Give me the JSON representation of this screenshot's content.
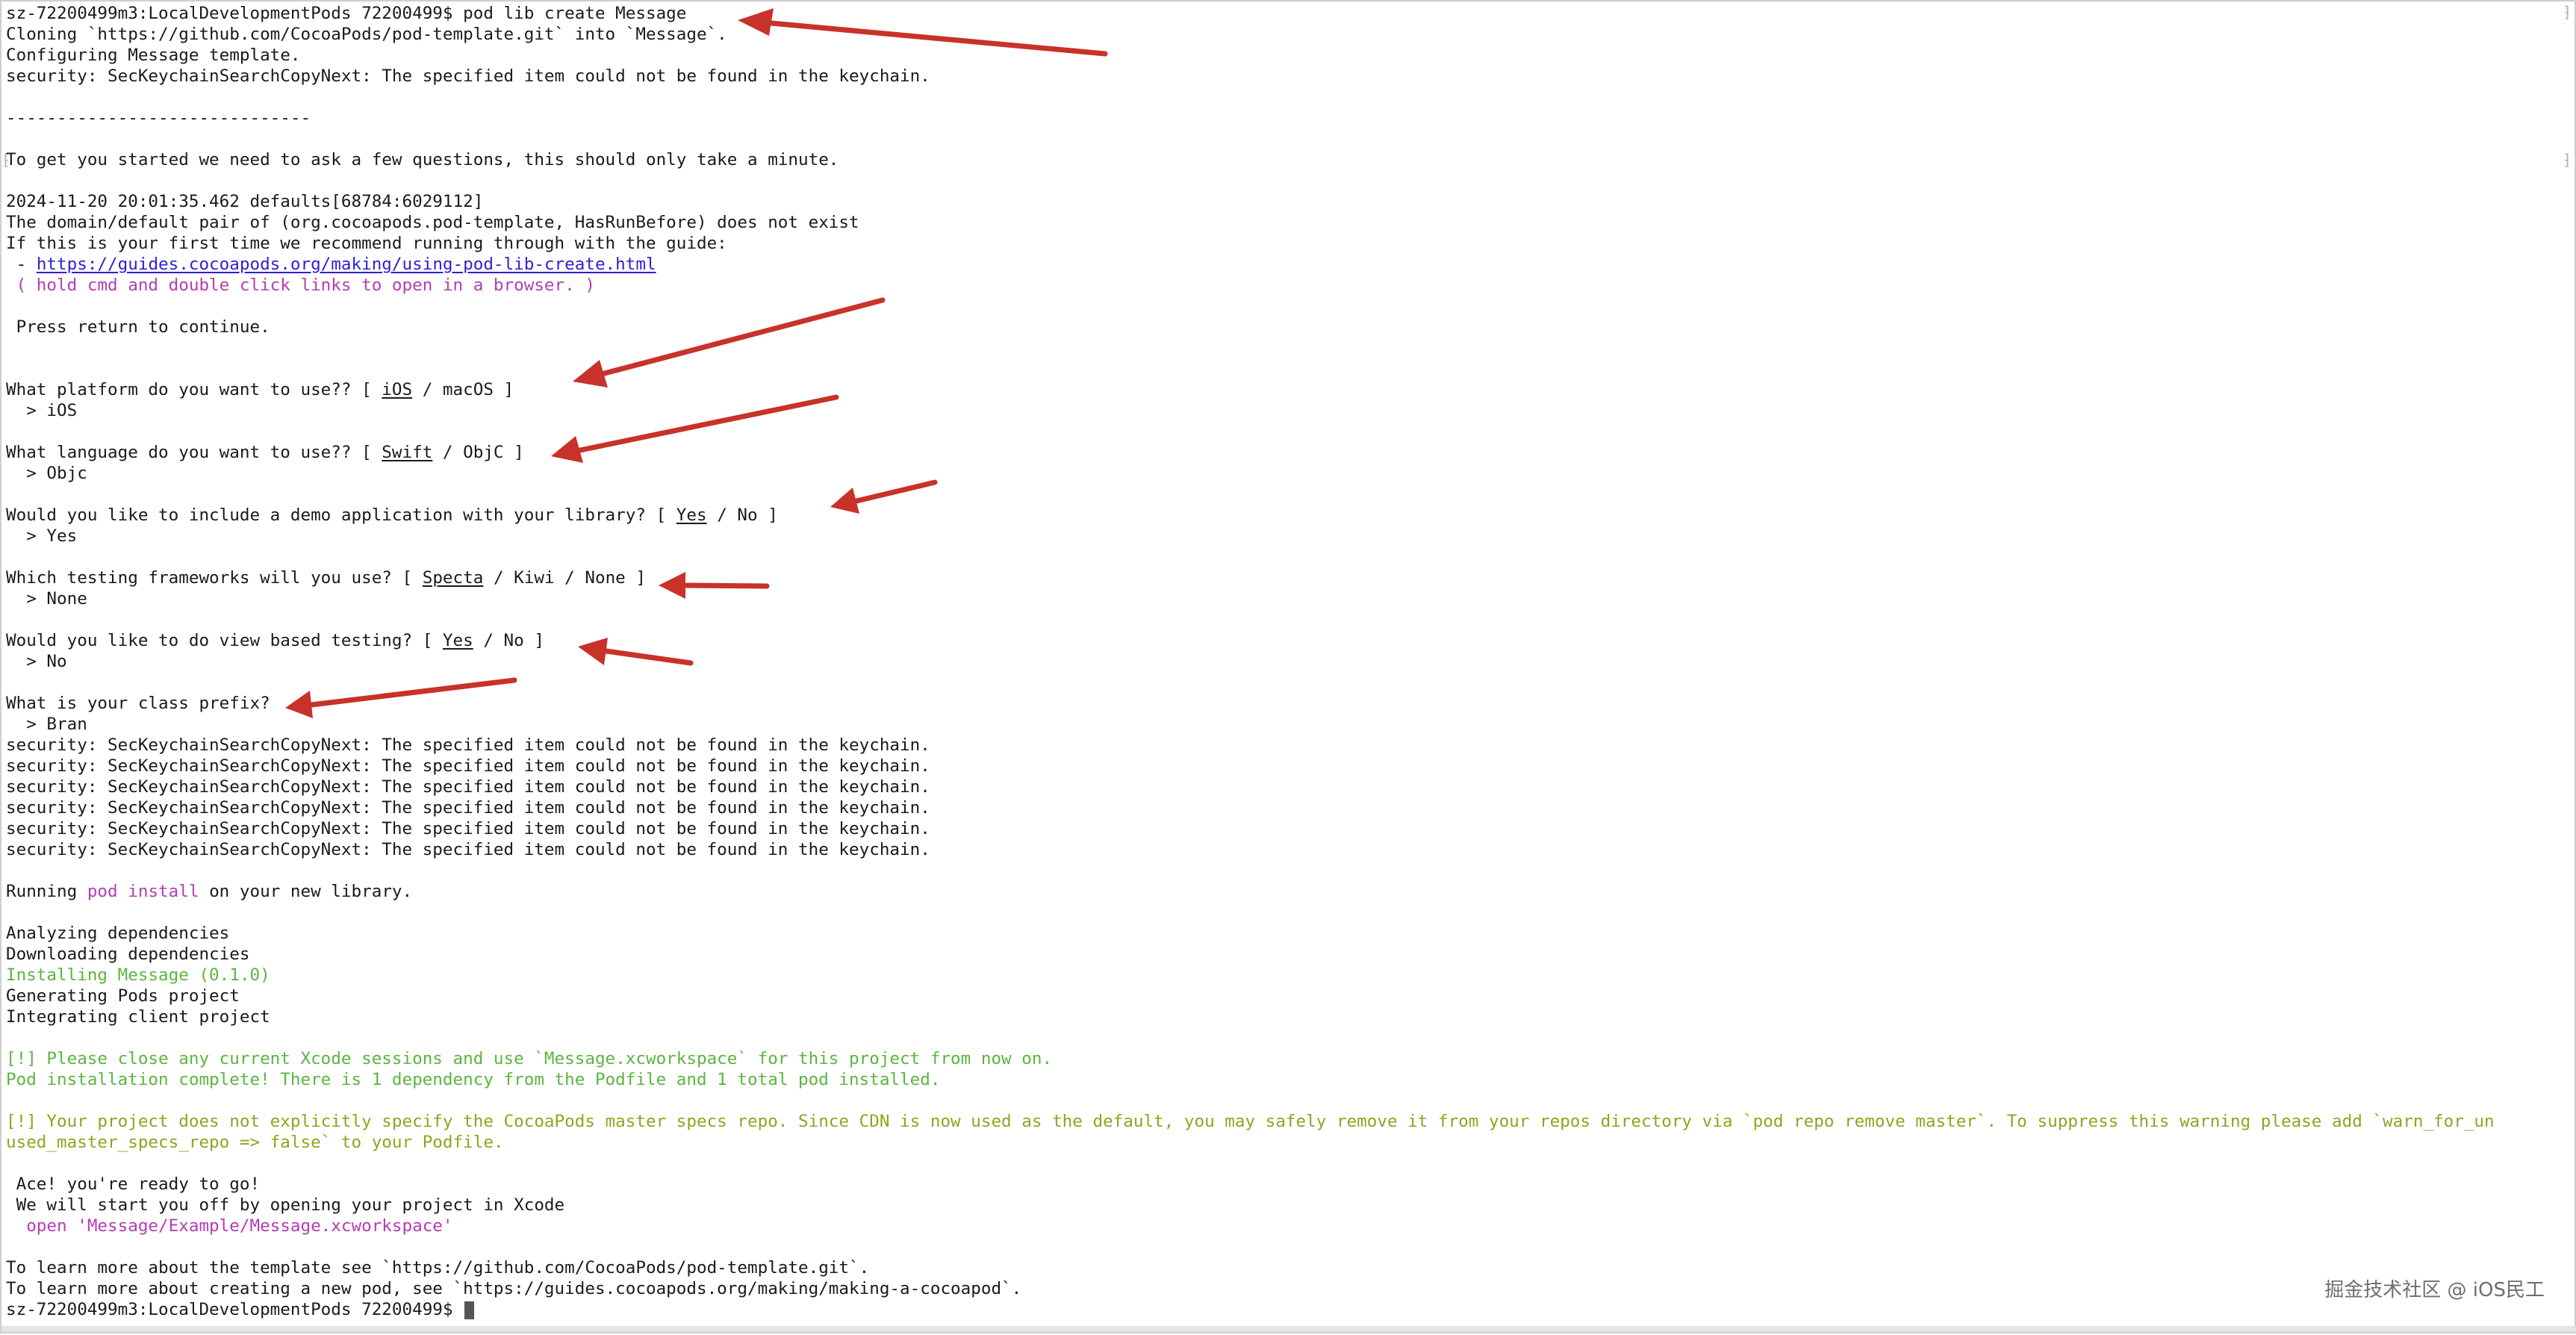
{
  "terminal": {
    "prompt": "sz-72200499m3:LocalDevelopmentPods 72200499$ ",
    "command": "pod lib create Message",
    "cloning": "Cloning `https://github.com/CocoaPods/pod-template.git` into `Message`.",
    "configuring": "Configuring Message template.",
    "security_error": "security: SecKeychainSearchCopyNext: The specified item could not be found in the keychain.",
    "separator": "------------------------------",
    "intro": "To get you started we need to ask a few questions, this should only take a minute.",
    "defaults_log": "2024-11-20 20:01:35.462 defaults[68784:6029112]",
    "domain_msg": "The domain/default pair of (org.cocoapods.pod-template, HasRunBefore) does not exist",
    "first_time": "If this is your first time we recommend running through with the guide:",
    "guide_prefix": " - ",
    "guide_link": "https://guides.cocoapods.org/making/using-pod-lib-create.html",
    "hold_cmd": " ( hold cmd and double click links to open in a browser. )",
    "press_return": " Press return to continue.",
    "answer_prefix": "  > ",
    "questions": {
      "platform": {
        "text": "What platform do you want to use?? [ ",
        "default_option": "iOS",
        "rest": " / macOS ]",
        "answer": "iOS"
      },
      "language": {
        "text": "What language do you want to use?? [ ",
        "default_option": "Swift",
        "rest": " / ObjC ]",
        "answer": "Objc"
      },
      "demo": {
        "text": "Would you like to include a demo application with your library? [ ",
        "default_option": "Yes",
        "rest": " / No ]",
        "answer": "Yes"
      },
      "testing": {
        "text": "Which testing frameworks will you use? [ ",
        "default_option": "Specta",
        "rest": " / Kiwi / None ]",
        "answer": "None"
      },
      "view_testing": {
        "text": "Would you like to do view based testing? [ ",
        "default_option": "Yes",
        "rest": " / No ]",
        "answer": "No"
      },
      "prefix": {
        "text": "What is your class prefix?",
        "answer": "Bran"
      }
    },
    "running_prefix": "Running ",
    "running_cmd": "pod install",
    "running_suffix": " on your new library.",
    "analyzing": "Analyzing dependencies",
    "downloading": "Downloading dependencies",
    "installing": "Installing Message (0.1.0)",
    "generating": "Generating Pods project",
    "integrating": "Integrating client project",
    "close_xcode": "[!] Please close any current Xcode sessions and use `Message.xcworkspace` for this project from now on.",
    "install_complete": "Pod installation complete! There is 1 dependency from the Podfile and 1 total pod installed.",
    "master_warning_1": "[!] Your project does not explicitly specify the CocoaPods master specs repo. Since CDN is now used as the default, you may safely remove it from your repos directory via `pod repo remove master`. To suppress this warning please add `warn_for_un",
    "master_warning_2": "used_master_specs_repo => false` to your Podfile.",
    "ace": " Ace! you're ready to go!",
    "start_off": " We will start you off by opening your project in Xcode",
    "open_cmd": "  open 'Message/Example/Message.xcworkspace'",
    "learn_template": "To learn more about the template see `https://github.com/CocoaPods/pod-template.git`.",
    "learn_pod": "To learn more about creating a new pod, see `https://guides.cocoapods.org/making/making-a-cocoapod`.",
    "final_prompt": "sz-72200499m3:LocalDevelopmentPods 72200499$ "
  },
  "watermark": "掘金技术社区 @ iOS民工",
  "colors": {
    "text": "#1a1a1a",
    "link": "#2e1fd6",
    "magenta": "#b53db2",
    "green": "#5bb53f",
    "olive": "#94a21e",
    "arrow": "#c8322a"
  }
}
